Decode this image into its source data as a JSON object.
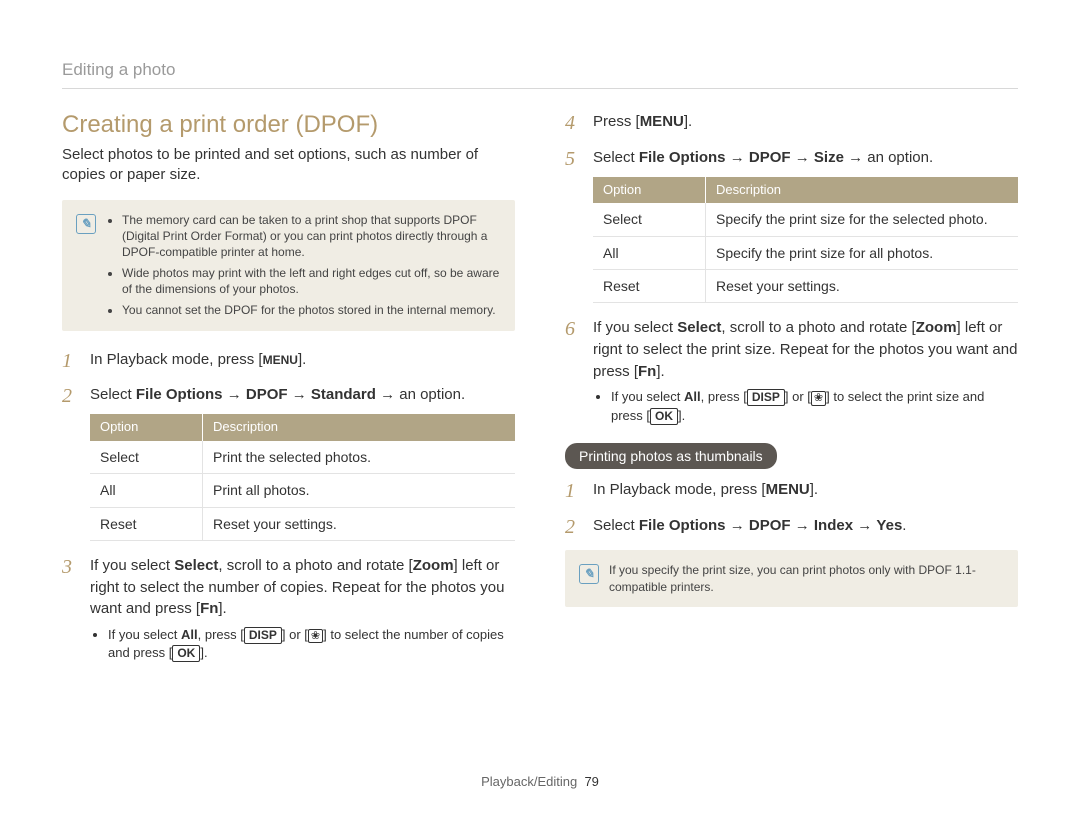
{
  "header": "Editing a photo",
  "section_title": "Creating a print order (DPOF)",
  "intro": "Select photos to be printed and set options, such as number of copies or paper size.",
  "note1": [
    "The memory card can be taken to a print shop that supports DPOF (Digital Print Order Format) or you can print photos directly through a DPOF-compatible printer at home.",
    "Wide photos may print with the left and right edges cut off, so be aware of the dimensions of your photos.",
    "You cannot set the DPOF for the photos stored in the internal memory."
  ],
  "labels": {
    "menu": "MENU",
    "disp": "DISP",
    "fn": "Fn",
    "ok": "OK"
  },
  "steps_a": {
    "s1_pre": "In Playback mode, press [",
    "s1_post": "].",
    "s2_pre": "Select ",
    "s2_b1": "File Options",
    "s2_arr": " → ",
    "s2_b2": "DPOF",
    "s2_b3": "Standard",
    "s2_post": " → an option.",
    "s3_a": "If you select ",
    "s3_b": "Select",
    "s3_c": ", scroll to a photo and rotate [",
    "s3_d": "Zoom",
    "s3_e": "] left or right to select the number of copies. Repeat for the photos you want and press [",
    "s3_f": "].",
    "s3_sub_a": "If you select ",
    "s3_sub_b": "All",
    "s3_sub_c": ", press [",
    "s3_sub_d": "] or [",
    "s3_sub_e": "] to select the number of copies and press [",
    "s3_sub_f": "]."
  },
  "table1": {
    "h1": "Option",
    "h2": "Description",
    "rows": [
      {
        "o": "Select",
        "d": "Print the selected photos."
      },
      {
        "o": "All",
        "d": "Print all photos."
      },
      {
        "o": "Reset",
        "d": "Reset your settings."
      }
    ]
  },
  "steps_b": {
    "s4_pre": "Press [",
    "s4_post": "].",
    "s5_pre": "Select ",
    "s5_b1": "File Options",
    "s5_arr": " → ",
    "s5_b2": "DPOF",
    "s5_b3": "Size",
    "s5_post": " → an option.",
    "s6_a": "If you select ",
    "s6_b": "Select",
    "s6_c": ", scroll to a photo and rotate [",
    "s6_d": "Zoom",
    "s6_e": "] left or rignt to select the print size. Repeat for the photos you want and press [",
    "s6_f": "].",
    "s6_sub_a": "If you select ",
    "s6_sub_b": "All",
    "s6_sub_c": ", press [",
    "s6_sub_d": "] or [",
    "s6_sub_e": "] to select the print size and press [",
    "s6_sub_f": "]."
  },
  "table2": {
    "h1": "Option",
    "h2": "Description",
    "rows": [
      {
        "o": "Select",
        "d": "Specify the print size for the selected photo."
      },
      {
        "o": "All",
        "d": "Specify the print size for all photos."
      },
      {
        "o": "Reset",
        "d": "Reset your settings."
      }
    ]
  },
  "pill": "Printing photos as thumbnails",
  "steps_c": {
    "s1_pre": "In Playback mode, press [",
    "s1_post": "].",
    "s2_pre": "Select ",
    "s2_b1": "File Options",
    "s2_arr": " → ",
    "s2_b2": "DPOF",
    "s2_b3": "Index",
    "s2_b4": "Yes",
    "s2_post": "."
  },
  "note2": "If you specify the print size, you can print photos only with DPOF 1.1-compatible printers.",
  "footer_section": "Playback/Editing",
  "footer_page": "79"
}
